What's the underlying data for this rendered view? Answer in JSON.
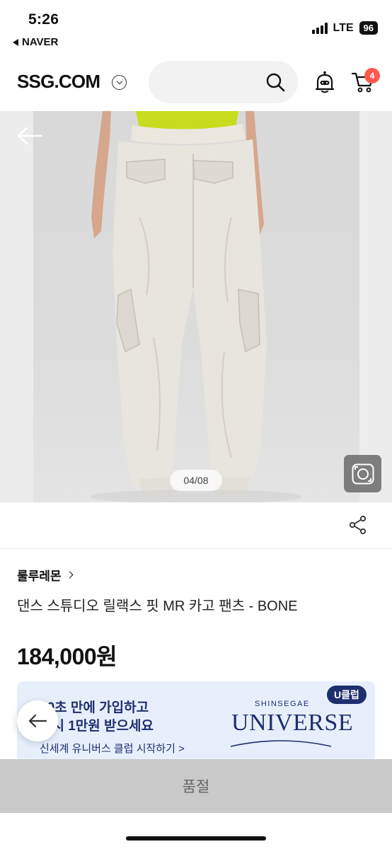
{
  "status_bar": {
    "time": "5:26",
    "back_app": "NAVER",
    "network": "LTE",
    "battery": "96"
  },
  "header": {
    "logo": "SSG.COM",
    "search_placeholder": "",
    "cart_count": "4"
  },
  "gallery": {
    "counter": "04/08"
  },
  "product": {
    "brand": "룰루레몬",
    "name": "댄스 스튜디오 릴랙스 핏 MR 카고 팬츠 - BONE",
    "price": "184,000원"
  },
  "banner": {
    "line1": "10초 만에 가입하고",
    "line2": "즉시 1만원 받으세요",
    "link": "신세계 유니버스 클럽 시작하기 >",
    "brand_small": "SHINSEGAE",
    "brand_big": "UNIVERSE",
    "badge": "U클럽"
  },
  "footer": {
    "soldout_label": "품절"
  },
  "colors": {
    "accent_badge": "#ff5a4e",
    "banner_bg": "#e7effd",
    "banner_text": "#1d2f6e",
    "soldout_bg": "#c9c9c9"
  }
}
